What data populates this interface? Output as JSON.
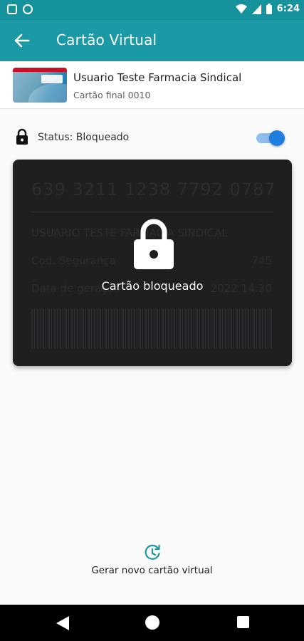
{
  "status_bar": {
    "time": "6:24",
    "icons": [
      "square-notification-icon",
      "circle-notification-icon",
      "wifi-icon",
      "signal-icon",
      "battery-icon"
    ]
  },
  "toolbar": {
    "title": "Cartão Virtual",
    "back_icon": "arrow-back-icon"
  },
  "card_header": {
    "holder_name": "Usuario Teste Farmacia Sindical",
    "card_final": "Cartão final 0010"
  },
  "status": {
    "label": "Status: Bloqueado",
    "toggle_on": true,
    "icon": "lock-icon"
  },
  "virtual_card": {
    "number": "639  3211  1238  7792  0787",
    "holder": "USUARIO TESTE FARMACIA SINDICAL",
    "security_label": "Cod. Segurança",
    "security_value": "745",
    "generated_label": "Data de geração",
    "generated_value": "2022 14:30",
    "blocked_label": "Cartão bloqueado"
  },
  "regenerate": {
    "label": "Gerar novo cartão virtual",
    "icon": "refresh-clock-icon"
  },
  "colors": {
    "toolbar": "#1b9aa6",
    "status_bar": "#15929c",
    "card_bg": "#1e1f21",
    "toggle_accent": "#1e7fe0"
  }
}
